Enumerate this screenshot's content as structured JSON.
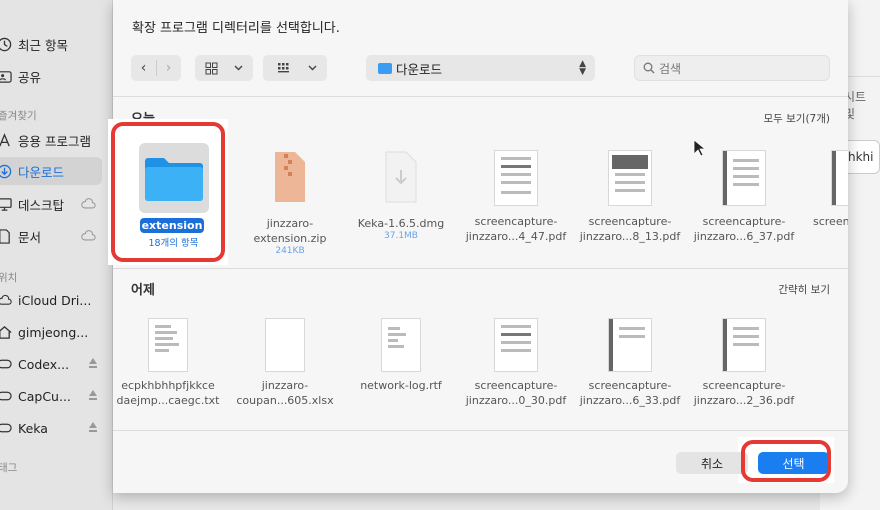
{
  "dialog": {
    "title": "확장 프로그램 디렉터리를 선택합니다.",
    "location": "다운로드",
    "search_placeholder": "검색",
    "cancel_label": "취소",
    "select_label": "선택"
  },
  "sidebar": {
    "items_top": [
      {
        "label": "최근 항목",
        "icon": "clock-icon"
      },
      {
        "label": "공유",
        "icon": "shared-icon"
      }
    ],
    "favorites_header": "즐겨찾기",
    "favorites": [
      {
        "label": "응용 프로그램",
        "icon": "apps-icon"
      },
      {
        "label": "다운로드",
        "icon": "download-icon",
        "active": true
      },
      {
        "label": "데스크탑",
        "icon": "desktop-icon",
        "cloud": true
      },
      {
        "label": "문서",
        "icon": "document-icon",
        "cloud": true
      }
    ],
    "locations_header": "위치",
    "locations": [
      {
        "label": "iCloud Dri...",
        "icon": "cloud-icon"
      },
      {
        "label": "gimjeong...",
        "icon": "home-icon"
      },
      {
        "label": "Codex...",
        "icon": "drive-icon",
        "eject": true
      },
      {
        "label": "CapCu...",
        "icon": "drive-icon",
        "eject": true
      },
      {
        "label": "Keka",
        "icon": "drive-icon",
        "eject": true
      }
    ],
    "tags_header": "태그"
  },
  "sections": [
    {
      "title": "오늘",
      "link": "모두 보기(7개)",
      "files": [
        {
          "name": "extension",
          "sub": "18개의 항목",
          "kind": "folder",
          "selected": true
        },
        {
          "name": "jinzzaro-extension.zip",
          "sub": "241KB",
          "kind": "zip"
        },
        {
          "name": "Keka-1.6.5.dmg",
          "sub": "37.1MB",
          "kind": "dmg"
        },
        {
          "name": "screencapture-jinzzaro...4_47.pdf",
          "kind": "pdf"
        },
        {
          "name": "screencapture-jinzzaro...8_13.pdf",
          "kind": "pdf"
        },
        {
          "name": "screencapture-jinzzaro...6_37.pdf",
          "kind": "pdf"
        },
        {
          "name": "screen jinzzaro",
          "kind": "pdf"
        }
      ]
    },
    {
      "title": "어제",
      "link": "간략히 보기",
      "files": [
        {
          "name": "ecpkhbhhpfjkkce daejmp...caegc.txt",
          "kind": "txt"
        },
        {
          "name": "jinzzaro-coupan...605.xlsx",
          "kind": "xlsx"
        },
        {
          "name": "network-log.rtf",
          "kind": "rtf"
        },
        {
          "name": "screencapture-jinzzaro...0_30.pdf",
          "kind": "pdf"
        },
        {
          "name": "screencapture-jinzzaro...6_33.pdf",
          "kind": "pdf"
        },
        {
          "name": "screencapture-jinzzaro...2_36.pdf",
          "kind": "pdf"
        }
      ]
    }
  ],
  "background": {
    "snippet1": "시트 및",
    "snippet2": "hkhi"
  },
  "colors": {
    "accent": "#1a7ef0",
    "highlight": "#e53a33",
    "folder": "#3a9df3"
  }
}
